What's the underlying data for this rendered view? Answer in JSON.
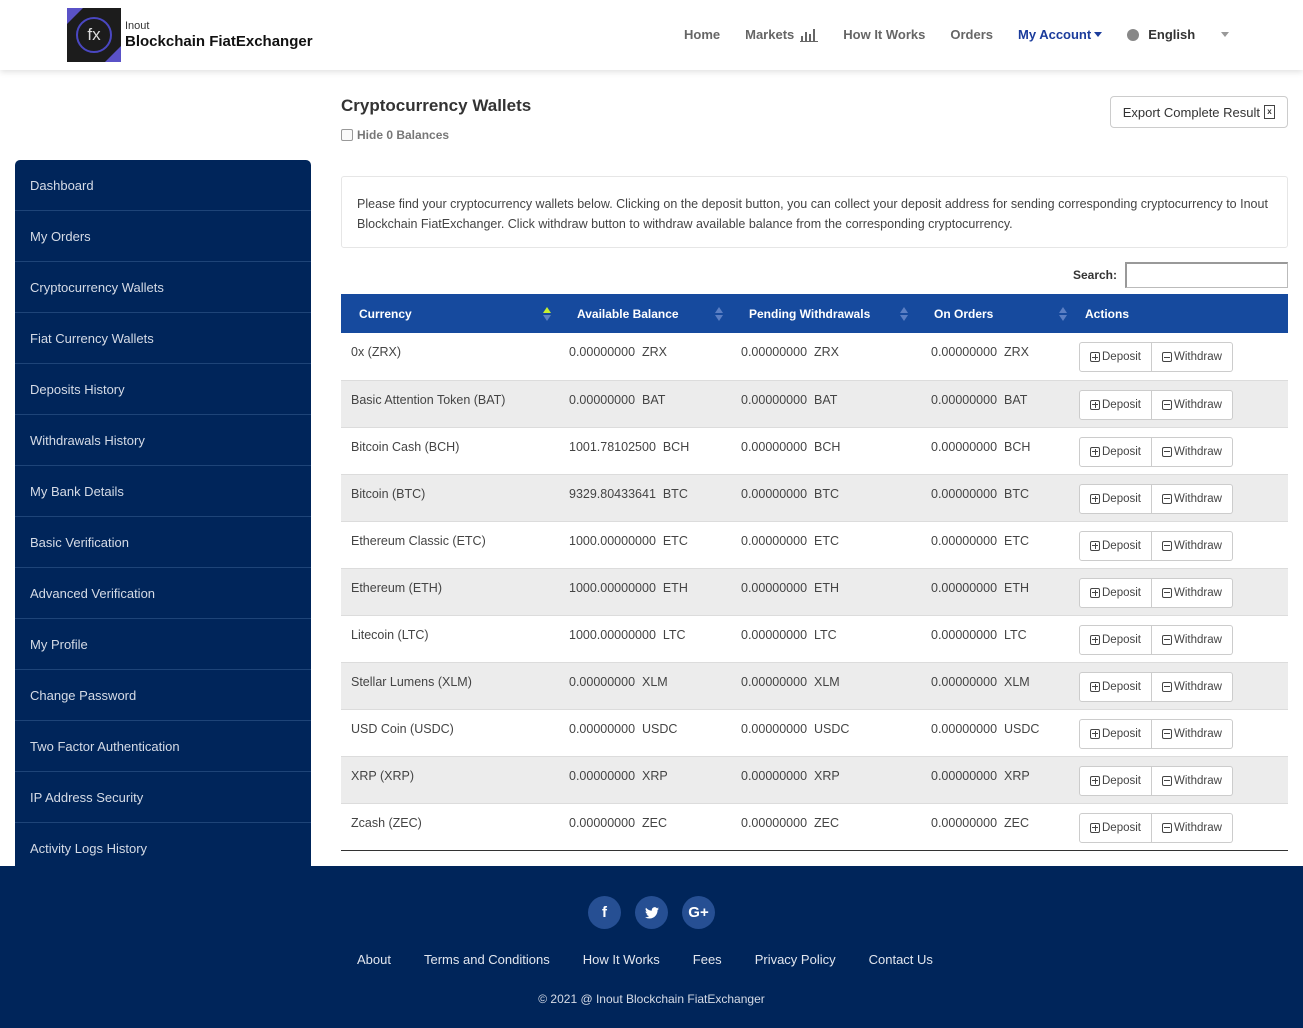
{
  "header": {
    "logo_small": "Inout",
    "logo_main": "Blockchain FiatExchanger",
    "logo_glyph": "fx",
    "nav": [
      {
        "label": "Home"
      },
      {
        "label": "Markets"
      },
      {
        "label": "How It Works"
      },
      {
        "label": "Orders"
      },
      {
        "label": "My Account"
      }
    ],
    "language": "English"
  },
  "sidebar": {
    "items": [
      {
        "label": "Dashboard"
      },
      {
        "label": "My Orders"
      },
      {
        "label": "Cryptocurrency Wallets"
      },
      {
        "label": "Fiat Currency Wallets"
      },
      {
        "label": "Deposits History"
      },
      {
        "label": "Withdrawals History"
      },
      {
        "label": "My Bank Details"
      },
      {
        "label": "Basic Verification"
      },
      {
        "label": "Advanced Verification"
      },
      {
        "label": "My Profile"
      },
      {
        "label": "Change Password"
      },
      {
        "label": "Two Factor Authentication"
      },
      {
        "label": "IP Address Security"
      },
      {
        "label": "Activity Logs History"
      }
    ]
  },
  "main": {
    "title": "Cryptocurrency Wallets",
    "hide_zero_label": "Hide 0 Balances",
    "export_label": "Export Complete Result",
    "info_text": "Please find your cryptocurrency wallets below. Clicking on the deposit button, you can collect your deposit address for sending corresponding cryptocurrency to Inout Blockchain FiatExchanger. Click withdraw button to withdraw available balance from the corresponding cryptocurrency.",
    "search_label": "Search:",
    "search_value": "",
    "columns": [
      "Currency",
      "Available Balance",
      "Pending Withdrawals",
      "On Orders",
      "Actions"
    ],
    "deposit_label": "Deposit",
    "withdraw_label": "Withdraw",
    "rows": [
      {
        "currency": "0x (ZRX)",
        "available": "0.00000000  ZRX",
        "pending": "0.00000000  ZRX",
        "orders": "0.00000000  ZRX"
      },
      {
        "currency": "Basic Attention Token (BAT)",
        "available": "0.00000000  BAT",
        "pending": "0.00000000  BAT",
        "orders": "0.00000000  BAT"
      },
      {
        "currency": "Bitcoin Cash (BCH)",
        "available": "1001.78102500  BCH",
        "pending": "0.00000000  BCH",
        "orders": "0.00000000  BCH"
      },
      {
        "currency": "Bitcoin (BTC)",
        "available": "9329.80433641  BTC",
        "pending": "0.00000000  BTC",
        "orders": "0.00000000  BTC"
      },
      {
        "currency": "Ethereum Classic (ETC)",
        "available": "1000.00000000  ETC",
        "pending": "0.00000000  ETC",
        "orders": "0.00000000  ETC"
      },
      {
        "currency": "Ethereum (ETH)",
        "available": "1000.00000000  ETH",
        "pending": "0.00000000  ETH",
        "orders": "0.00000000  ETH"
      },
      {
        "currency": "Litecoin (LTC)",
        "available": "1000.00000000  LTC",
        "pending": "0.00000000  LTC",
        "orders": "0.00000000  LTC"
      },
      {
        "currency": "Stellar Lumens (XLM)",
        "available": "0.00000000  XLM",
        "pending": "0.00000000  XLM",
        "orders": "0.00000000  XLM"
      },
      {
        "currency": "USD Coin (USDC)",
        "available": "0.00000000  USDC",
        "pending": "0.00000000  USDC",
        "orders": "0.00000000  USDC"
      },
      {
        "currency": "XRP (XRP)",
        "available": "0.00000000  XRP",
        "pending": "0.00000000  XRP",
        "orders": "0.00000000  XRP"
      },
      {
        "currency": "Zcash (ZEC)",
        "available": "0.00000000  ZEC",
        "pending": "0.00000000  ZEC",
        "orders": "0.00000000  ZEC"
      }
    ]
  },
  "footer": {
    "social": [
      {
        "icon": "facebook-icon",
        "glyph": "f"
      },
      {
        "icon": "twitter-icon",
        "glyph": "t"
      },
      {
        "icon": "google-plus-icon",
        "glyph": "G+"
      }
    ],
    "links": [
      "About",
      "Terms and Conditions",
      "How It Works",
      "Fees",
      "Privacy Policy",
      "Contact Us"
    ],
    "copyright": "© 2021 @ Inout Blockchain FiatExchanger"
  },
  "colors": {
    "navy": "#00255a",
    "table_header": "#164a9e",
    "active_nav": "#1b3c9c",
    "sort_active": "#c6f02e"
  }
}
